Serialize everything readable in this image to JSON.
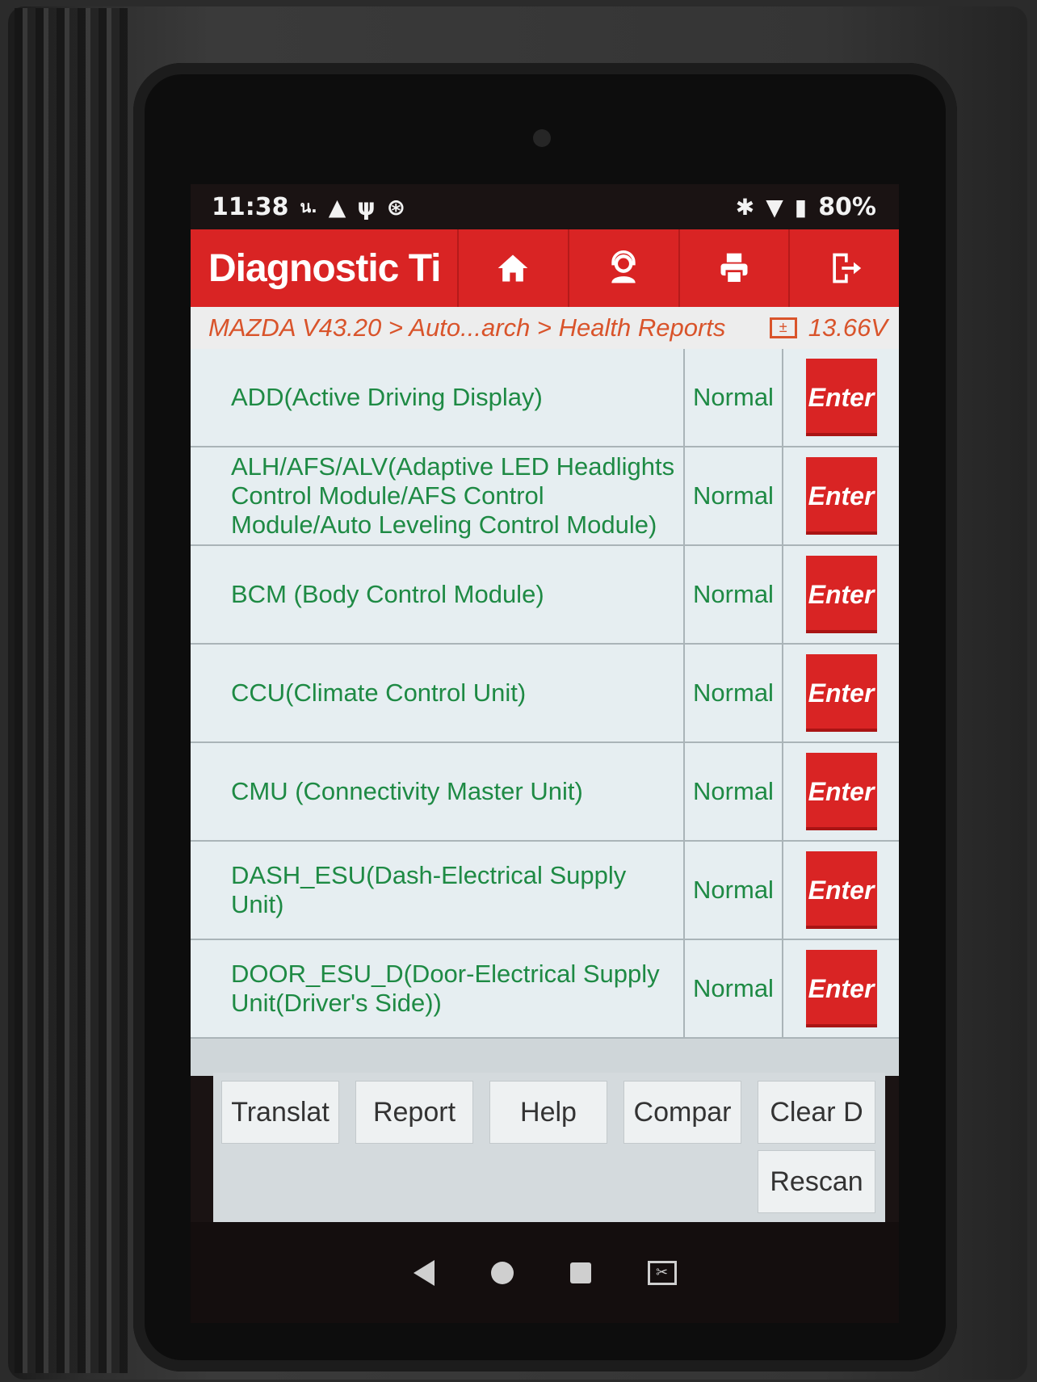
{
  "status_bar": {
    "time": "11:38",
    "left_icons": [
      "ul-icon",
      "warning-icon",
      "usb-icon",
      "vci-icon"
    ],
    "battery": "80%"
  },
  "app_bar": {
    "title": "Diagnostic Ti",
    "buttons": [
      "home-icon",
      "support-icon",
      "print-icon",
      "exit-icon"
    ]
  },
  "breadcrumb": {
    "path": "MAZDA V43.20 > Auto...arch > Health Reports",
    "voltage": "13.66V"
  },
  "modules": [
    {
      "name": "ADD(Active Driving Display)",
      "status": "Normal",
      "action": "Enter"
    },
    {
      "name": "ALH/AFS/ALV(Adaptive LED Headlights Control Module/AFS Control Module/Auto Leveling Control Module)",
      "status": "Normal",
      "action": "Enter"
    },
    {
      "name": "BCM (Body Control Module)",
      "status": "Normal",
      "action": "Enter"
    },
    {
      "name": "CCU(Climate Control Unit)",
      "status": "Normal",
      "action": "Enter"
    },
    {
      "name": "CMU (Connectivity Master Unit)",
      "status": "Normal",
      "action": "Enter"
    },
    {
      "name": "DASH_ESU(Dash-Electrical Supply Unit)",
      "status": "Normal",
      "action": "Enter"
    },
    {
      "name": "DOOR_ESU_D(Door-Electrical Supply Unit(Driver's Side))",
      "status": "Normal",
      "action": "Enter"
    }
  ],
  "toolbar": {
    "translate": "Translat",
    "report": "Report",
    "help": "Help",
    "compare": "Compar",
    "clear_dtc": "Clear D",
    "rescan": "Rescan"
  },
  "colors": {
    "accent_red": "#d92424",
    "status_green": "#1e8a44",
    "breadcrumb_orange": "#d9542b"
  }
}
